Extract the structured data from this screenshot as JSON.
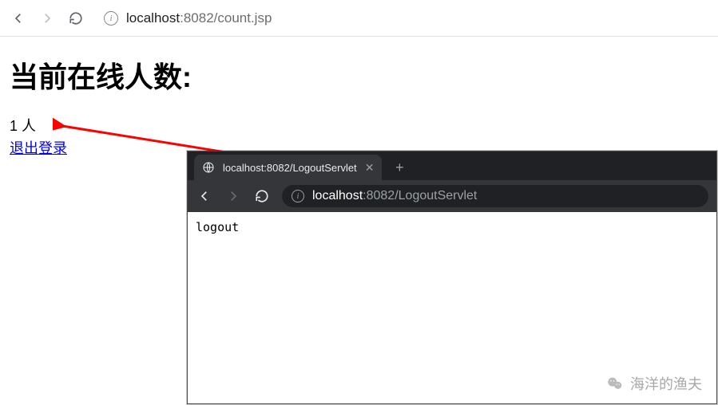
{
  "top_browser": {
    "url_domain": "localhost",
    "url_port_path": ":8082/count.jsp"
  },
  "page": {
    "heading": "当前在线人数:",
    "count_text": "1 人",
    "logout_label": "退出登录"
  },
  "inner_browser": {
    "tab_title": "localhost:8082/LogoutServlet",
    "url_domain": "localhost",
    "url_port_path": ":8082/LogoutServlet",
    "body_text": "logout"
  },
  "watermark": {
    "text": "海洋的渔夫"
  }
}
